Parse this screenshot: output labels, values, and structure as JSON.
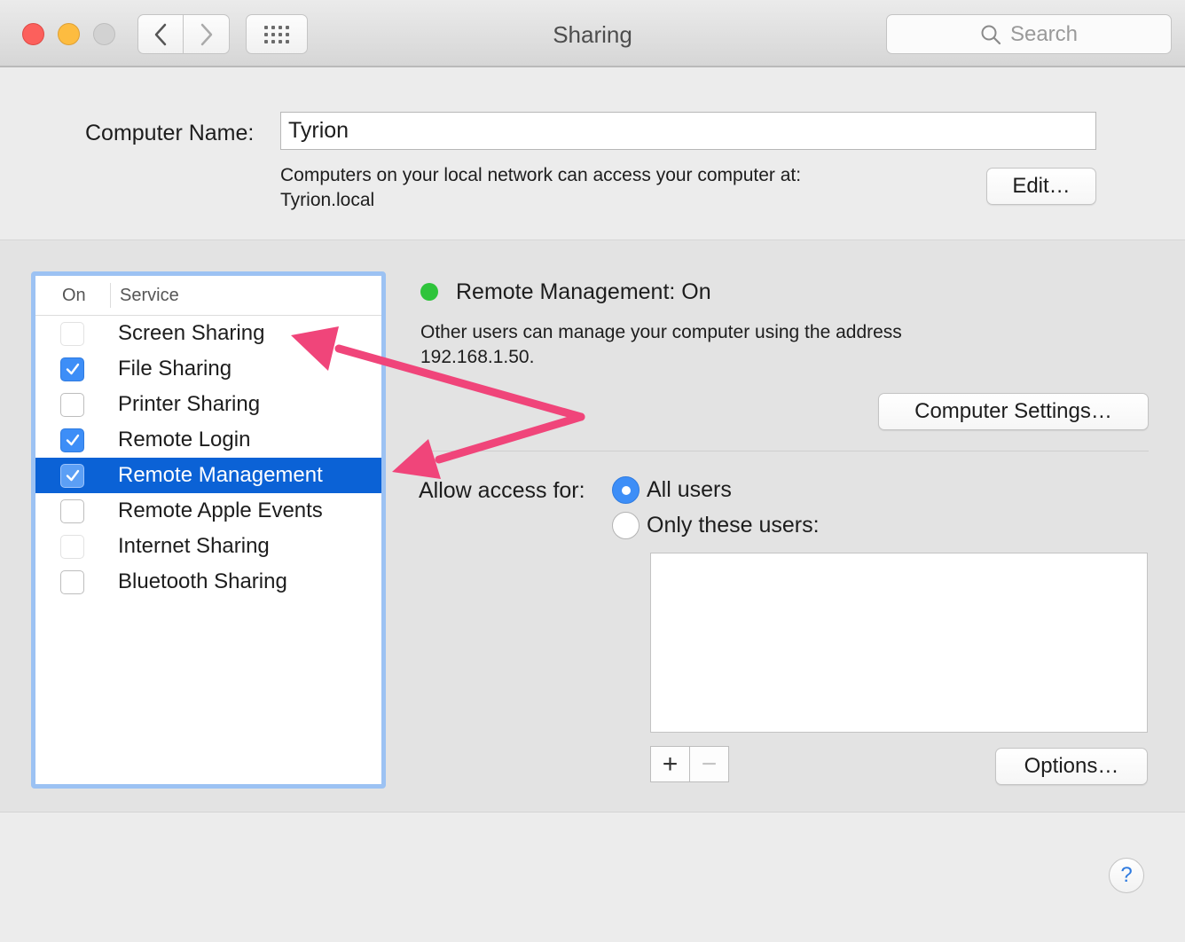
{
  "window": {
    "title": "Sharing",
    "search_placeholder": "Search",
    "nav_back": "‹",
    "nav_forward": "›"
  },
  "computer_name": {
    "label": "Computer Name:",
    "value": "Tyrion",
    "description_line1": "Computers on your local network can access your computer at:",
    "description_line2": "Tyrion.local",
    "edit_label": "Edit…"
  },
  "services": {
    "header_on": "On",
    "header_service": "Service",
    "items": [
      {
        "name": "Screen Sharing",
        "checked": false,
        "faded": true,
        "selected": false
      },
      {
        "name": "File Sharing",
        "checked": true,
        "faded": false,
        "selected": false
      },
      {
        "name": "Printer Sharing",
        "checked": false,
        "faded": false,
        "selected": false
      },
      {
        "name": "Remote Login",
        "checked": true,
        "faded": false,
        "selected": false
      },
      {
        "name": "Remote Management",
        "checked": true,
        "faded": false,
        "selected": true
      },
      {
        "name": "Remote Apple Events",
        "checked": false,
        "faded": false,
        "selected": false
      },
      {
        "name": "Internet Sharing",
        "checked": false,
        "faded": true,
        "selected": false
      },
      {
        "name": "Bluetooth Sharing",
        "checked": false,
        "faded": false,
        "selected": false
      }
    ]
  },
  "detail": {
    "status": "Remote Management: On",
    "status_color": "#2ec43b",
    "description_line1": "Other users can manage your computer using the address",
    "description_line2": "192.168.1.50.",
    "computer_settings_label": "Computer Settings…",
    "allow_access_label": "Allow access for:",
    "radio_all_users": "All users",
    "radio_only_these": "Only these users:",
    "selected_radio": "all",
    "plus_label": "+",
    "minus_label": "−",
    "options_label": "Options…"
  },
  "help_label": "?",
  "colors": {
    "accent": "#3d8ef7",
    "selection": "#0b62d6",
    "annotation_arrow": "#f0457a"
  }
}
